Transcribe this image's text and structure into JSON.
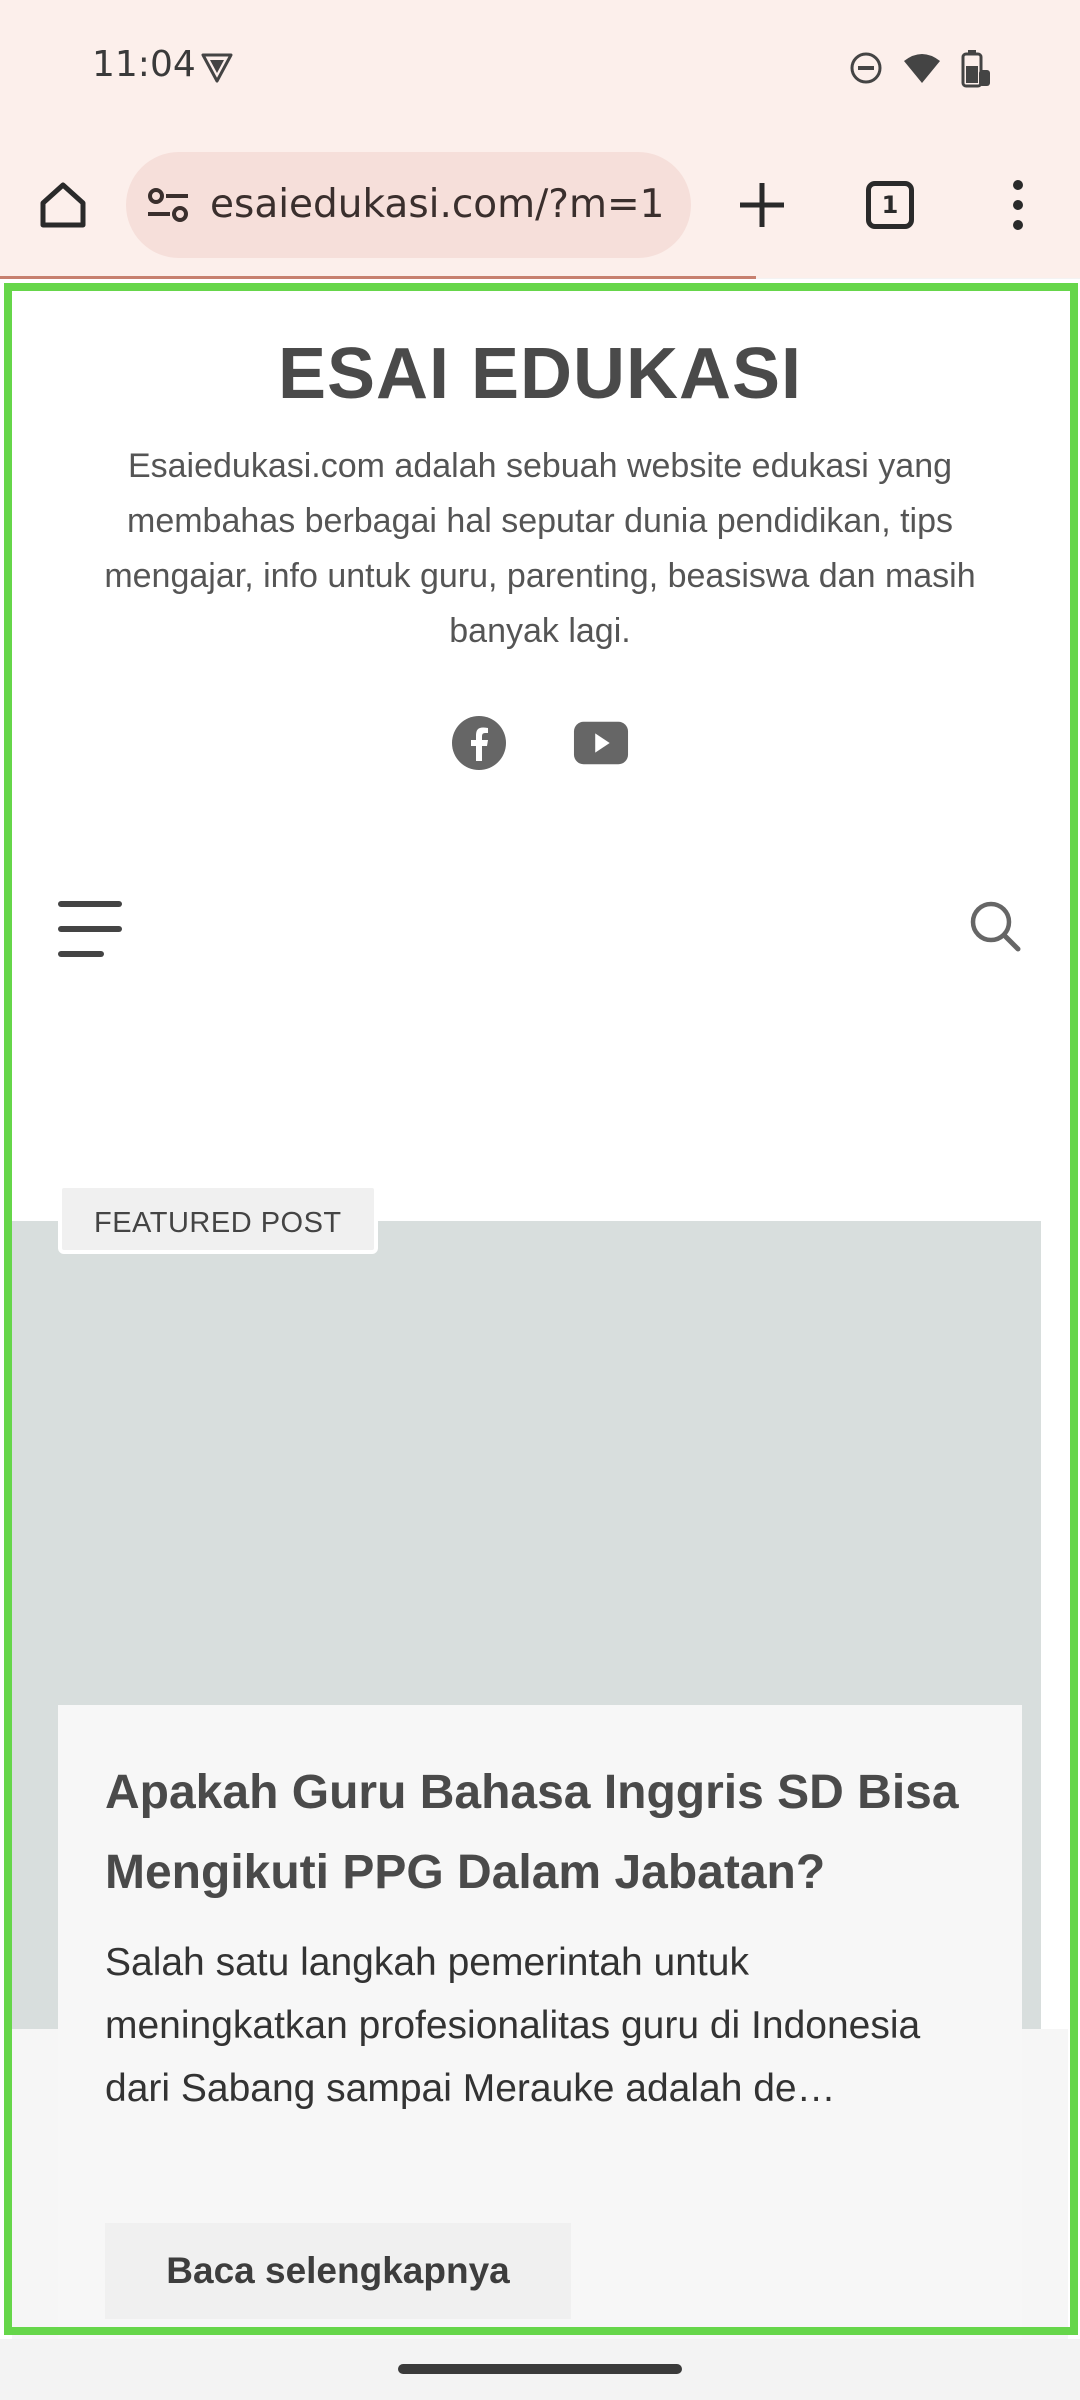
{
  "status_bar": {
    "time": "11:04",
    "icons": [
      "vpn-icon",
      "do-not-disturb-icon",
      "wifi-icon",
      "battery-icon"
    ]
  },
  "browser": {
    "url": "esaiedukasi.com/?m=1",
    "tab_count": "1",
    "icons": [
      "home-icon",
      "site-settings-icon",
      "new-tab-icon",
      "tab-switcher-icon",
      "more-menu-icon"
    ]
  },
  "site": {
    "title": "ESAI EDUKASI",
    "description": "Esaiedukasi.com adalah sebuah website edukasi yang membahas berbagai hal seputar dunia pendidikan, tips mengajar, info untuk guru, parenting, beasiswa dan masih banyak lagi.",
    "social_icons": [
      "facebook-icon",
      "youtube-icon"
    ]
  },
  "featured": {
    "badge": "FEATURED POST",
    "post_title": "Apakah Guru Bahasa Inggris SD Bisa Mengikuti PPG Dalam Jabatan?",
    "excerpt": "Salah satu langkah pemerintah untuk meningkatkan profesionalitas guru di Indonesia dari Sabang sampai Merauke adalah de…",
    "read_more": "Baca selengkapnya"
  },
  "colors": {
    "chrome_bg": "#fcefeb",
    "url_bar_bg": "#f6dfda",
    "highlight": "#66d64a",
    "featured_image_bg": "#d8dedd"
  }
}
